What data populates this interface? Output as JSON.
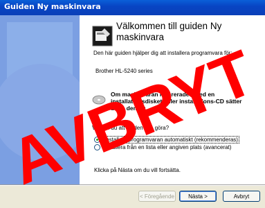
{
  "window": {
    "title": "Guiden Ny maskinvara"
  },
  "content": {
    "heading_line1": "Välkommen till guiden Ny",
    "heading_line2": "maskinvara",
    "intro": "Den här guiden hjälper dig att installera programvara för:",
    "device": "Brother HL-5240 series",
    "cd_note_line1": "Om maskinvaran levererades med en",
    "cd_note_line2": "installationsdiskett eller installations-CD sätter",
    "cd_note_line3": "du in den nu.",
    "question": "Vad vill du att guiden ska göra?",
    "option_auto": "Installera programvaran automatiskt (rekommenderas)",
    "option_manual": "Installera från en lista eller angiven plats (avancerat)",
    "next_hint": "Klicka på Nästa om du vill fortsätta."
  },
  "buttons": {
    "back": "< Föregående",
    "next": "Nästa >",
    "cancel": "Avbryt"
  },
  "stamp": {
    "text": "AVBRYT",
    "color": "#ff0000"
  }
}
